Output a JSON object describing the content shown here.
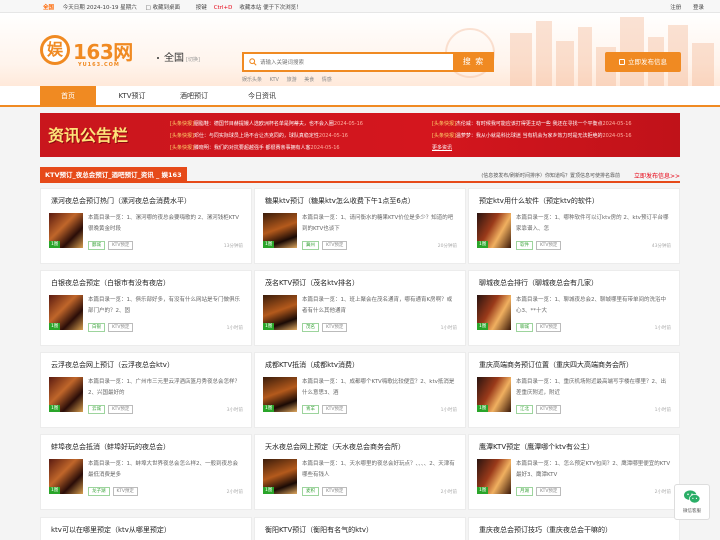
{
  "topbar": {
    "brand": "全国",
    "date": "今天日期 2024-10-19 星期六",
    "bookmark": "收藏到桌面",
    "tip_prefix": "按键",
    "tip_key": "Ctrl+D",
    "tip_suffix": "收藏本站 便于下次浏览！",
    "register": "注册",
    "login": "登录"
  },
  "header": {
    "logo_char": "娱",
    "logo_name": "163网",
    "logo_url": "YU163.COM",
    "city": "全国",
    "city_switch": "[切换]",
    "search_placeholder": "请输入关键词搜索",
    "search_button": "搜 索",
    "hotwords": [
      "娱乐头条",
      "KTV",
      "旅游",
      "美食",
      "情感"
    ],
    "publish": "立即发布信息"
  },
  "nav": [
    "首页",
    "KTV预订",
    "酒吧预订",
    "今日资讯"
  ],
  "banner": {
    "title": "资讯公告栏",
    "news": [
      {
        "tag": "[头条快报]",
        "text": "胭脂鞋：德国节目赫提娥人选欧洲杯名单是阿蒂夫，也不会入圈",
        "date": "2024-05-16"
      },
      {
        "tag": "[头条快报]",
        "text": "杰伦威：有时候我可能应该打得更主动一些 我还在寻找一个平衡点",
        "date": "2024-05-16"
      },
      {
        "tag": "[头条快报]",
        "text": "邓仕：与同实际球员上场不合让杰克同的，球队真稳定性",
        "date": "2024-05-16"
      },
      {
        "tag": "[头条快报]",
        "text": "温萝梦：我从小就是科比球迷 当有机会为家乡效力时是无法拒绝的",
        "date": "2024-05-16"
      },
      {
        "tag": "[头条快报]",
        "text": "滕晓明：我们的对抗要超越强手 都很赛亲事拥有人客",
        "date": "2024-05-16"
      }
    ],
    "more": "更多资讯"
  },
  "section": {
    "title": "KTV预订_夜总会预订_酒吧预订_资讯 _ 娱163",
    "tip": "(信息按发布/刷新时间排序）你知道吗？置顶信息可使排名靠前",
    "link": "立即发布信息>>"
  },
  "cards": [
    {
      "title": "漯河夜总会预订热门（漯河夜总会消费水平）",
      "desc": "本篇目录一览：1、漯河哪的夜总会要嗨歌的 2、漯河钱柜KTV很晚黄金时段",
      "count": "1图",
      "city": "郾城",
      "type": "KTV预定",
      "time": "13分钟前"
    },
    {
      "title": "糖果ktv预订（糖果ktv怎么收费下午1点至6点）",
      "desc": "本篇目录一览：1、请问衡水的糖果KTV价位是多少？知道的吧到的KTV也谈下",
      "count": "1图",
      "city": "冀州",
      "type": "KTV预定",
      "time": "20分钟前"
    },
    {
      "title": "预定ktv用什么软件（预定ktv的软件）",
      "desc": "本篇目录一览：1、哪种软件可以订ktv房的 2、ktv预订平台哪家靠谱入、怎",
      "count": "1图",
      "city": "软件",
      "type": "KTV预定",
      "time": "43分钟前"
    },
    {
      "title": "白银夜总会预定（白银市有没有夜店）",
      "desc": "本篇目录一览：1、俱乐部好多，有没有什么网站是专门做俱乐部门户的？2、固",
      "count": "1图",
      "city": "白银",
      "type": "KTV预定",
      "time": "1小时前"
    },
    {
      "title": "茂名KTV预订（茂名ktv排名）",
      "desc": "本篇目录一览：1、班上聚会在茂名通宵，哪有通宵K房啊？或者有什么其他通宵",
      "count": "1图",
      "city": "茂名",
      "type": "KTV预定",
      "time": "1小时前"
    },
    {
      "title": "聊城夜总会排行（聊城夜总会有几家）",
      "desc": "本篇目录一览：1、聊城夜总会2、聊城哪里有带单间的洗浴中心3、**十大",
      "count": "1图",
      "city": "聊城",
      "type": "KTV预定",
      "time": "1小时前"
    },
    {
      "title": "云浮夜总会网上预订（云浮夜总会ktv）",
      "desc": "本篇目录一览：1、广州市三元里云浮酒店篮月秀夜总会怎样？2、兴国最好的",
      "count": "1图",
      "city": "云城",
      "type": "KTV预定",
      "time": "3小时前"
    },
    {
      "title": "成都KTV抵消（成都ktv消费）",
      "desc": "本篇目录一览：1、成都哪个KTV嗨歌比较便宜？2、ktv抵消是什么意思3、酒",
      "count": "1图",
      "city": "青羊",
      "type": "KTV预定",
      "time": "1小时前"
    },
    {
      "title": "重庆高端商务预订位置（重庆四大高端商务会所）",
      "desc": "本篇目录一览：1、重庆机场附近最高端写字楼在哪里？2、出差重庆附近，附近",
      "count": "1图",
      "city": "江北",
      "type": "KTV预定",
      "time": "1小时前"
    },
    {
      "title": "蚌埠夜总会抵消（蚌埠好玩的夜总会）",
      "desc": "本篇目录一览：1、蚌埠大世界夜总会怎么样2、一般到夜总会最低消费是多",
      "count": "1图",
      "city": "龙子湖",
      "type": "KTV预定",
      "time": "2小时前"
    },
    {
      "title": "天水夜总会网上预定（天水夜总会商务会所）",
      "desc": "本篇目录一览：1、天水哪里的夜总会好玩点？、、、、2、天津有哪些有钱人",
      "count": "1图",
      "city": "麦积",
      "type": "KTV预定",
      "time": "2小时前"
    },
    {
      "title": "鹰潭KTV预定（鹰潭哪个ktv有公主）",
      "desc": "本篇目录一览：1、怎么预定KTV包间？2、鹰潭哪里便宜的KTV最好3、鹰潭KTV",
      "count": "1图",
      "city": "月湖",
      "type": "KTV预定",
      "time": "2小时前"
    }
  ],
  "partial_cards": [
    "ktv可以在哪里预定（ktv从哪里预定）",
    "衡阳KTV预订（衡阳有名气的ktv）",
    "重庆夜总会预订技巧（重庆夜总会干嘛的）"
  ],
  "wechat": "微信客服"
}
